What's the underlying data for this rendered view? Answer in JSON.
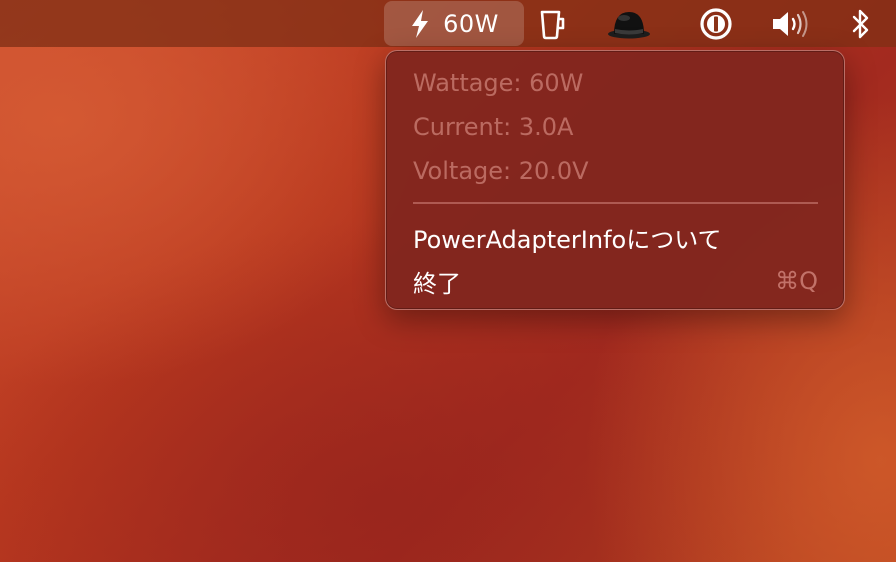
{
  "menubar": {
    "power": {
      "label": "60W",
      "icon": "bolt-icon"
    },
    "icons": [
      "coffee-cup-icon",
      "bowler-hat-icon",
      "one-password-icon",
      "volume-icon",
      "bluetooth-icon"
    ]
  },
  "menu": {
    "wattage": "Wattage: 60W",
    "current": "Current: 3.0A",
    "voltage": "Voltage: 20.0V",
    "about": "PowerAdapterInfoについて",
    "quit": "終了",
    "quit_shortcut": "⌘Q"
  },
  "colors": {
    "menubar": "#823016",
    "menu_background": "#80261e",
    "disabled_text": "#c87a70",
    "enabled_text": "#ffffff"
  }
}
